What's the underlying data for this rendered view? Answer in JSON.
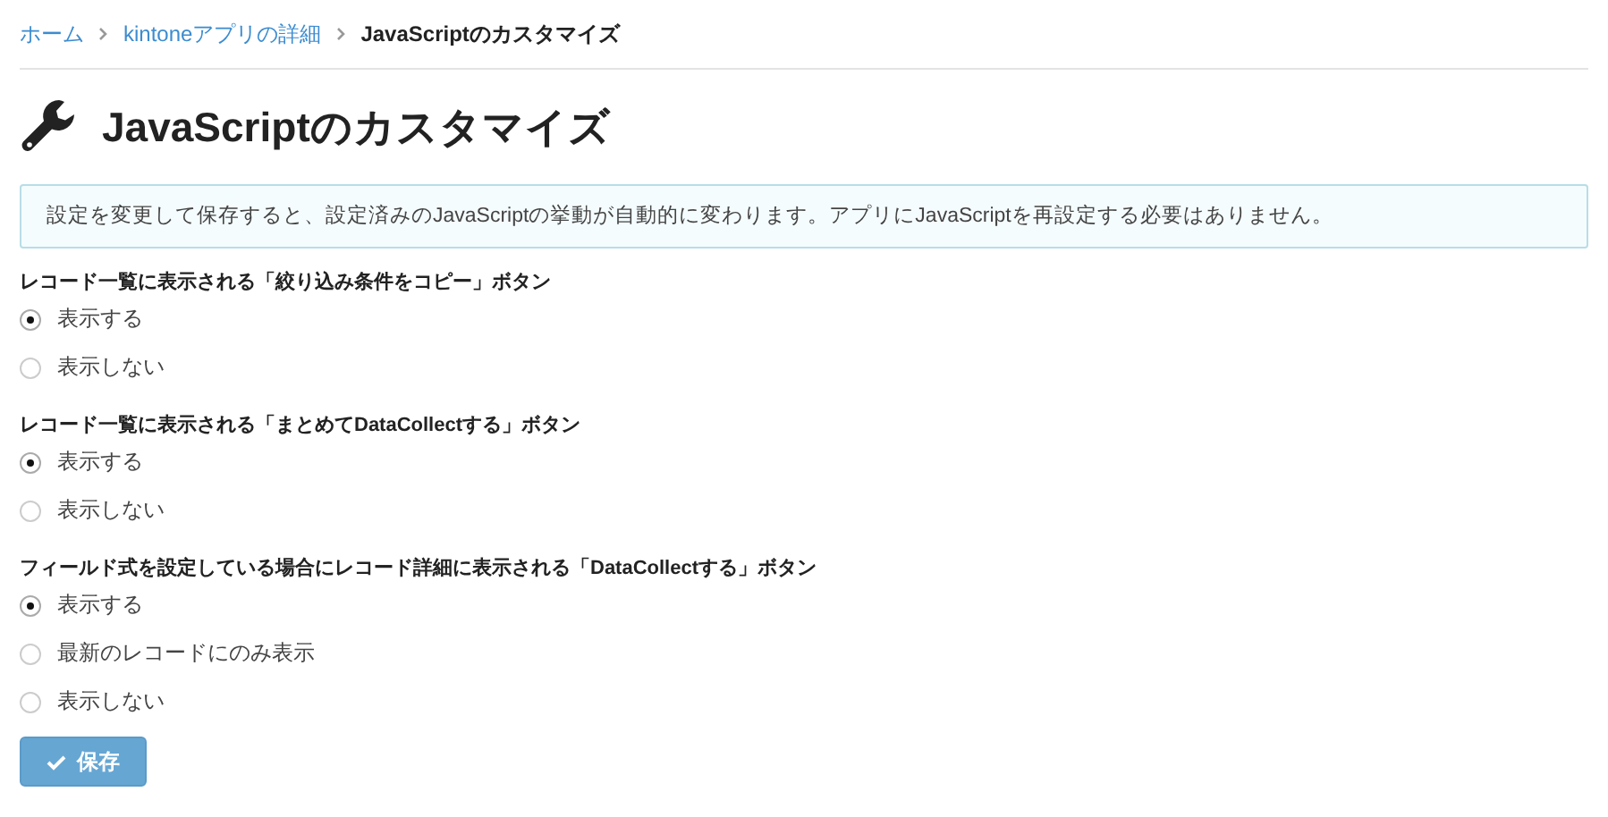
{
  "breadcrumb": [
    {
      "label": "ホーム",
      "kind": "link"
    },
    {
      "label": "kintoneアプリの詳細",
      "kind": "link"
    },
    {
      "label": "JavaScriptのカスタマイズ",
      "kind": "current"
    }
  ],
  "title": "JavaScriptのカスタマイズ",
  "notice": "設定を変更して保存すると、設定済みのJavaScriptの挙動が自動的に変わります。アプリにJavaScriptを再設定する必要はありません。",
  "groups": [
    {
      "label": "レコード一覧に表示される「絞り込み条件をコピー」ボタン",
      "options": [
        {
          "label": "表示する",
          "selected": true
        },
        {
          "label": "表示しない",
          "selected": false
        }
      ]
    },
    {
      "label": "レコード一覧に表示される「まとめてDataCollectする」ボタン",
      "options": [
        {
          "label": "表示する",
          "selected": true
        },
        {
          "label": "表示しない",
          "selected": false
        }
      ]
    },
    {
      "label": "フィールド式を設定している場合にレコード詳細に表示される「DataCollectする」ボタン",
      "options": [
        {
          "label": "表示する",
          "selected": true
        },
        {
          "label": "最新のレコードにのみ表示",
          "selected": false
        },
        {
          "label": "表示しない",
          "selected": false
        }
      ]
    }
  ],
  "save_button": {
    "label": "保存"
  }
}
